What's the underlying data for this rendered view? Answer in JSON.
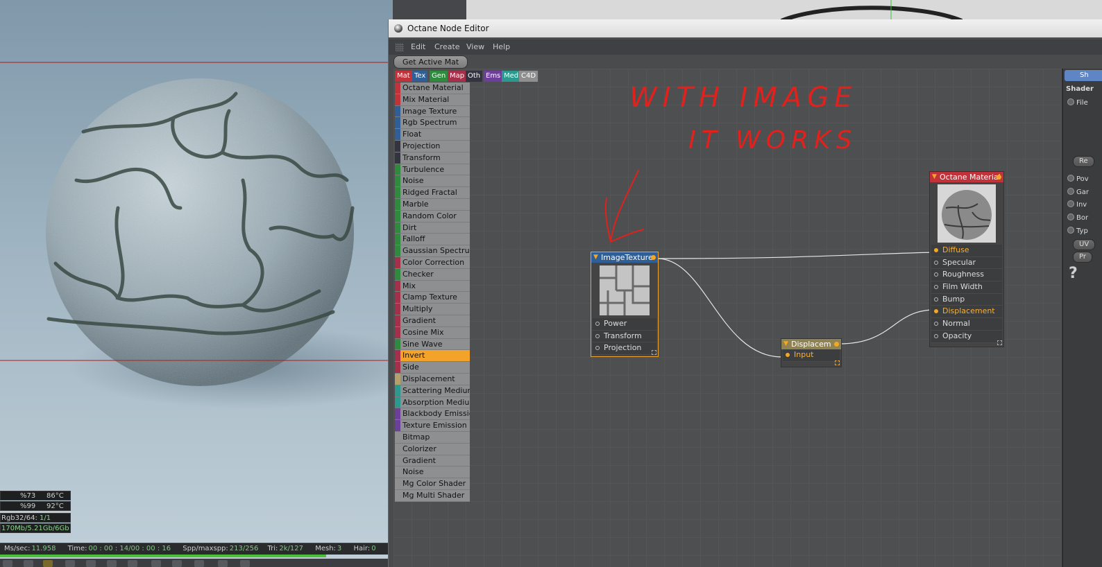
{
  "viewport": {
    "stats": {
      "gpu1_load": "%73",
      "gpu1_temp": "86°C",
      "gpu2_load": "%99",
      "gpu2_temp": "92°C",
      "kernel_label": "Rgb32/64:",
      "kernel_value": "1/1",
      "memory": "170Mb/5.21Gb/6Gb"
    },
    "status": {
      "ms_label": "Ms/sec:",
      "ms_value": "11.958",
      "time_label": "Time:",
      "time_value": "00 : 00 : 14/00 : 00 : 16",
      "spp_label": "Spp/maxspp:",
      "spp_value": "213/256",
      "tri_label": "Tri:",
      "tri_value": "2k/127",
      "mesh_label": "Mesh:",
      "mesh_value": "3",
      "hair_label": "Hair:",
      "hair_value": "0"
    },
    "progress": 0.83
  },
  "editor": {
    "title": "Octane Node Editor",
    "menu": [
      "Edit",
      "Create",
      "View",
      "Help"
    ],
    "get_active_mat": "Get Active Mat",
    "categories": [
      {
        "label": "Mat",
        "color": "#c0333a"
      },
      {
        "label": "Tex",
        "color": "#2f5f96"
      },
      {
        "label": "Gen",
        "color": "#2e8a3c"
      },
      {
        "label": "Map",
        "color": "#a4304a"
      },
      {
        "label": "Oth",
        "color": "#333440"
      },
      {
        "label": "Ems",
        "color": "#6d3f9a"
      },
      {
        "label": "Med",
        "color": "#2a9a8e"
      },
      {
        "label": "C4D",
        "color": "#8f8f8f"
      }
    ],
    "node_list": [
      {
        "label": "Octane Material",
        "color": "#c0333a"
      },
      {
        "label": "Mix Material",
        "color": "#c0333a"
      },
      {
        "label": "Image Texture",
        "color": "#2f5f96"
      },
      {
        "label": "Rgb Spectrum",
        "color": "#2f5f96"
      },
      {
        "label": "Float",
        "color": "#2f5f96"
      },
      {
        "label": "Projection",
        "color": "#333440"
      },
      {
        "label": "Transform",
        "color": "#333440"
      },
      {
        "label": "Turbulence",
        "color": "#2e8a3c"
      },
      {
        "label": "Noise",
        "color": "#2e8a3c"
      },
      {
        "label": "Ridged Fractal",
        "color": "#2e8a3c"
      },
      {
        "label": "Marble",
        "color": "#2e8a3c"
      },
      {
        "label": "Random Color",
        "color": "#2e8a3c"
      },
      {
        "label": "Dirt",
        "color": "#2e8a3c"
      },
      {
        "label": "Falloff",
        "color": "#2e8a3c"
      },
      {
        "label": "Gaussian Spectrum",
        "color": "#2e8a3c"
      },
      {
        "label": "Color Correction",
        "color": "#a4304a"
      },
      {
        "label": "Checker",
        "color": "#2e8a3c"
      },
      {
        "label": "Mix",
        "color": "#a4304a"
      },
      {
        "label": "Clamp Texture",
        "color": "#a4304a"
      },
      {
        "label": "Multiply",
        "color": "#a4304a"
      },
      {
        "label": "Gradient",
        "color": "#a4304a"
      },
      {
        "label": "Cosine Mix",
        "color": "#a4304a"
      },
      {
        "label": "Sine Wave",
        "color": "#2e8a3c"
      },
      {
        "label": "Invert",
        "color": "#a4304a",
        "selected": true
      },
      {
        "label": "Side",
        "color": "#a4304a"
      },
      {
        "label": "Displacement",
        "color": "#b3a06a"
      },
      {
        "label": "Scattering Medium",
        "color": "#2a9a8e"
      },
      {
        "label": "Absorption Medium",
        "color": "#2a9a8e"
      },
      {
        "label": "Blackbody Emission",
        "color": "#6d3f9a"
      },
      {
        "label": "Texture Emission",
        "color": "#6d3f9a"
      },
      {
        "label": "Bitmap",
        "color": "#8f8f8f"
      },
      {
        "label": "Colorizer",
        "color": "#8f8f8f"
      },
      {
        "label": "Gradient",
        "color": "#8f8f8f"
      },
      {
        "label": "Noise",
        "color": "#8f8f8f"
      },
      {
        "label": "Mg Color Shader",
        "color": "#8f8f8f"
      },
      {
        "label": "Mg Multi Shader",
        "color": "#8f8f8f"
      }
    ],
    "nodes": {
      "image_texture": {
        "title": "ImageTexture",
        "header_color": "#2f5f96",
        "pins": [
          "Power",
          "Transform",
          "Projection"
        ]
      },
      "displacement": {
        "title": "Displacem",
        "header_color": "#8f8354",
        "pins": [
          "Input"
        ]
      },
      "octane_material": {
        "title": "Octane Material",
        "header_color": "#c0333a",
        "pins": [
          "Diffuse",
          "Specular",
          "Roughness",
          "Film Width",
          "Bump",
          "Displacement",
          "Normal",
          "Opacity"
        ],
        "connected_pins": [
          "Diffuse",
          "Displacement"
        ]
      }
    },
    "annotation": {
      "line1": "WITH IMAGE",
      "line2": "IT WORKS",
      "color": "#e0211c"
    },
    "right_panel": {
      "tab": "Sh",
      "heading": "Shader",
      "radio_file": "File",
      "button_re": "Re",
      "radios": [
        "Pov",
        "Gar",
        "Inv",
        "Bor",
        "Typ"
      ],
      "button_uv": "UV",
      "button_pr": "Pr",
      "help_glyph": "?"
    }
  }
}
